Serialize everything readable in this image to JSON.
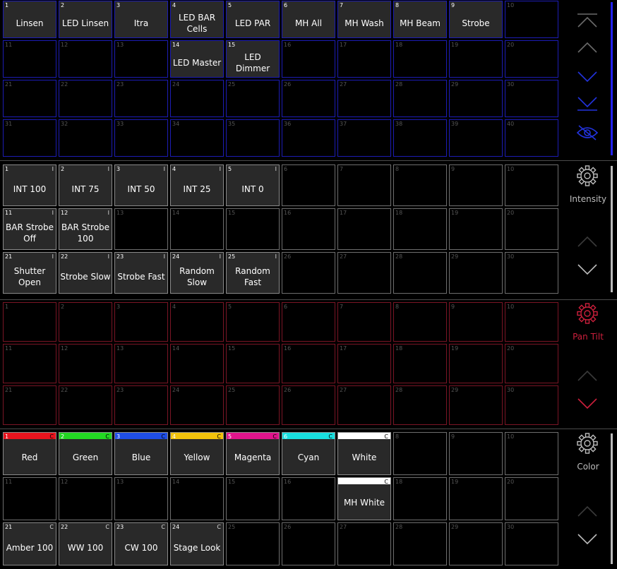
{
  "sections": [
    {
      "id": "groups",
      "rows": 4,
      "border": "#1c1cb4",
      "labels": [
        "Linsen",
        "LED Linsen",
        "Itra",
        "LED BAR Cells",
        "LED PAR",
        "MH All",
        "MH Wash",
        "MH Beam",
        "Strobe",
        "",
        "",
        "",
        "",
        "LED Master",
        "LED Dimmer",
        "",
        "",
        "",
        "",
        "",
        "",
        "",
        "",
        "",
        "",
        "",
        "",
        "",
        "",
        "",
        "",
        "",
        "",
        "",
        "",
        "",
        "",
        "",
        "",
        ""
      ],
      "flags": [],
      "colors": [],
      "side": {
        "label": "",
        "color": "#2233dd",
        "icons": [
          "go-top-icon",
          "arrow-up-icon",
          "arrow-down-icon",
          "go-bottom-icon",
          "visibility-icon"
        ]
      },
      "scroll_color": "#2222ee"
    },
    {
      "id": "intensity",
      "rows": 3,
      "border": "#6e6e6e",
      "labels": [
        "INT 100",
        "INT 75",
        "INT 50",
        "INT 25",
        "INT 0",
        "",
        "",
        "",
        "",
        "",
        "BAR Strobe Off",
        "BAR Strobe 100",
        "",
        "",
        "",
        "",
        "",
        "",
        "",
        "",
        "Shutter Open",
        "Strobe Slow",
        "Strobe Fast",
        "Random Slow",
        "Random Fast",
        "",
        "",
        "",
        "",
        ""
      ],
      "flags": [
        "I",
        "I",
        "I",
        "I",
        "I",
        "",
        "",
        "",
        "",
        "",
        "I",
        "I",
        "",
        "",
        "",
        "",
        "",
        "",
        "",
        "",
        "I",
        "I",
        "I",
        "I",
        "I",
        "",
        "",
        "",
        "",
        ""
      ],
      "colors": [],
      "side": {
        "label": "Intensity",
        "color": "#bdbdbd",
        "icons": [
          "gear-icon",
          "arrow-up-icon",
          "arrow-down-icon"
        ]
      },
      "scroll_color": "#bbbbbb"
    },
    {
      "id": "pantilt",
      "rows": 3,
      "border": "#7a1525",
      "labels": [
        "",
        "",
        "",
        "",
        "",
        "",
        "",
        "",
        "",
        "",
        "",
        "",
        "",
        "",
        "",
        "",
        "",
        "",
        "",
        "",
        "",
        "",
        "",
        "",
        "",
        "",
        "",
        "",
        "",
        ""
      ],
      "flags": [],
      "colors": [],
      "side": {
        "label": "Pan Tilt",
        "color": "#cc1f3c",
        "icons": [
          "gear-icon",
          "arrow-up-icon",
          "arrow-down-icon"
        ]
      },
      "scroll_color": ""
    },
    {
      "id": "color",
      "rows": 3,
      "border": "#6e6e6e",
      "labels": [
        "Red",
        "Green",
        "Blue",
        "Yellow",
        "Magenta",
        "Cyan",
        "White",
        "",
        "",
        "",
        "",
        "",
        "",
        "",
        "",
        "",
        "MH White",
        "",
        "",
        "",
        "Amber 100",
        "WW 100",
        "CW 100",
        "Stage Look",
        "",
        "",
        "",
        "",
        "",
        ""
      ],
      "flags": [
        "C",
        "C",
        "C",
        "C",
        "C",
        "C",
        "C",
        "",
        "",
        "",
        "",
        "",
        "",
        "",
        "",
        "",
        "C",
        "",
        "",
        "",
        "C",
        "C",
        "C",
        "C",
        "",
        "",
        "",
        "",
        "",
        ""
      ],
      "colors": [
        "#e8141e",
        "#23d823",
        "#1f4ee6",
        "#f2c20c",
        "#e0148c",
        "#19dede",
        "#ffffff",
        "",
        "",
        "",
        "",
        "",
        "",
        "",
        "",
        "",
        "#ffffff",
        "",
        "",
        "",
        "",
        "",
        "",
        "",
        "",
        "",
        "",
        "",
        "",
        ""
      ],
      "side": {
        "label": "Color",
        "color": "#bdbdbd",
        "icons": [
          "gear-icon",
          "arrow-up-icon",
          "arrow-down-icon"
        ]
      },
      "scroll_color": "#bbbbbb"
    }
  ]
}
